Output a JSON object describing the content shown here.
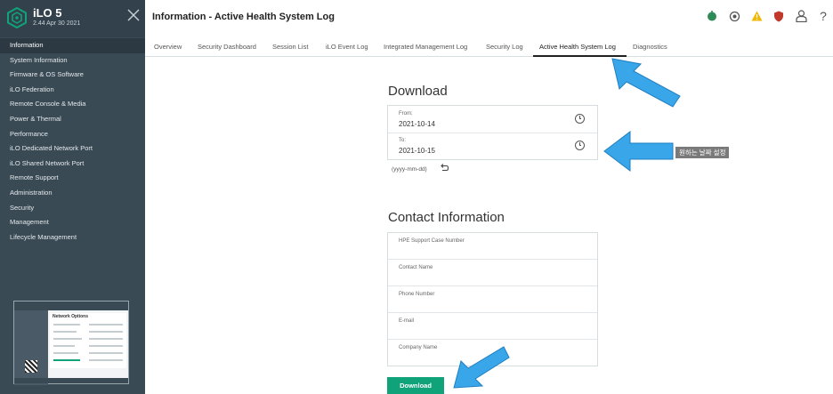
{
  "brand": {
    "title": "iLO 5",
    "version": "2.44 Apr 30 2021"
  },
  "sidebar": {
    "items": [
      {
        "label": "Information"
      },
      {
        "label": "System Information"
      },
      {
        "label": "Firmware & OS Software"
      },
      {
        "label": "iLO Federation"
      },
      {
        "label": "Remote Console & Media"
      },
      {
        "label": "Power & Thermal"
      },
      {
        "label": "Performance"
      },
      {
        "label": "iLO Dedicated Network Port"
      },
      {
        "label": "iLO Shared Network Port"
      },
      {
        "label": "Remote Support"
      },
      {
        "label": "Administration"
      },
      {
        "label": "Security"
      },
      {
        "label": "Management"
      },
      {
        "label": "Lifecycle Management"
      }
    ],
    "thumbnail_heading": "Network Options"
  },
  "header": {
    "title": "Information - Active Health System Log",
    "icons": [
      "health-status-icon",
      "target-icon",
      "warning-icon",
      "shield-icon",
      "user-icon",
      "help-icon"
    ],
    "help_label": "?"
  },
  "tabs": [
    {
      "label": "Overview"
    },
    {
      "label": "Security Dashboard"
    },
    {
      "label": "Session List"
    },
    {
      "label": "iLO Event Log"
    },
    {
      "label": "Integrated Management Log"
    },
    {
      "label": "Security Log"
    },
    {
      "label": "Active Health System Log"
    },
    {
      "label": "Diagnostics"
    }
  ],
  "download": {
    "title": "Download",
    "from_label": "From:",
    "from_value": "2021-10-14",
    "to_label": "To:",
    "to_value": "2021-10-15",
    "date_hint": "(yyyy-mm-dd)"
  },
  "contact": {
    "title": "Contact Information",
    "fields": [
      {
        "label": "HPE Support Case Number"
      },
      {
        "label": "Contact Name"
      },
      {
        "label": "Phone Number"
      },
      {
        "label": "E-mail"
      },
      {
        "label": "Company Name"
      }
    ]
  },
  "download_button": "Download",
  "annotation": {
    "callout_text": "원하는 날짜 설정"
  },
  "colors": {
    "sidebar_bg": "#3a4a55",
    "accent_green": "#10a37a",
    "annotation_arrow": "#3aa6ea",
    "warning": "#f2b705",
    "shield": "#c0392b"
  }
}
